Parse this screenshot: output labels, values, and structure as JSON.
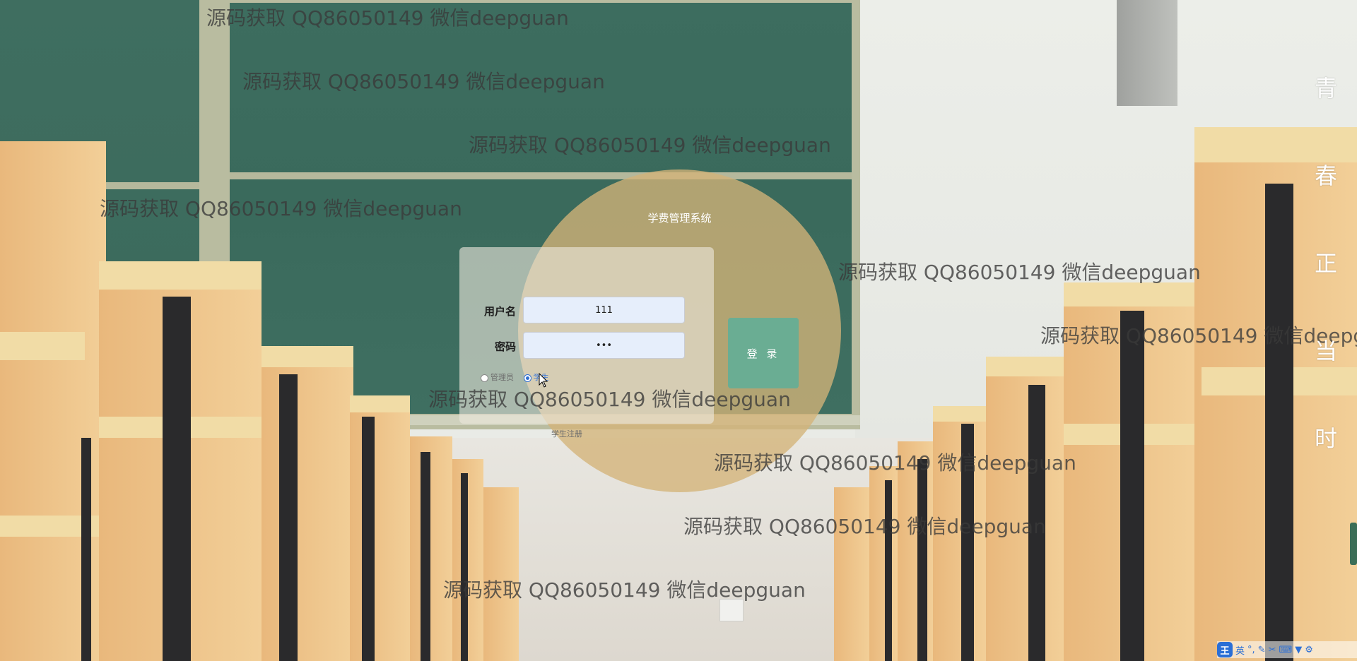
{
  "page": {
    "system_title": "学费管理系统"
  },
  "login": {
    "username_label": "用户名",
    "username_value": "111",
    "password_label": "密码",
    "password_value": "111",
    "roles": [
      {
        "label": "管理员",
        "checked": false
      },
      {
        "label": "学生",
        "checked": true
      }
    ],
    "login_button": "登 录",
    "register_link": "学生注册"
  },
  "watermark": {
    "text": "源码获取 QQ86050149 微信deepguan"
  },
  "poem": [
    "青",
    "春",
    "正",
    "当",
    "时"
  ],
  "ime_toolbar": {
    "logo": "王",
    "mode": "英",
    "icons": [
      "punctuation-icon",
      "pen-icon",
      "scissors-icon",
      "keyboard-icon",
      "shirt-icon",
      "settings-icon"
    ]
  },
  "colors": {
    "circle": "#d4b378",
    "login_button": "#6aad93",
    "input_bg": "#e6eefb",
    "board": "#3d6d5f"
  }
}
